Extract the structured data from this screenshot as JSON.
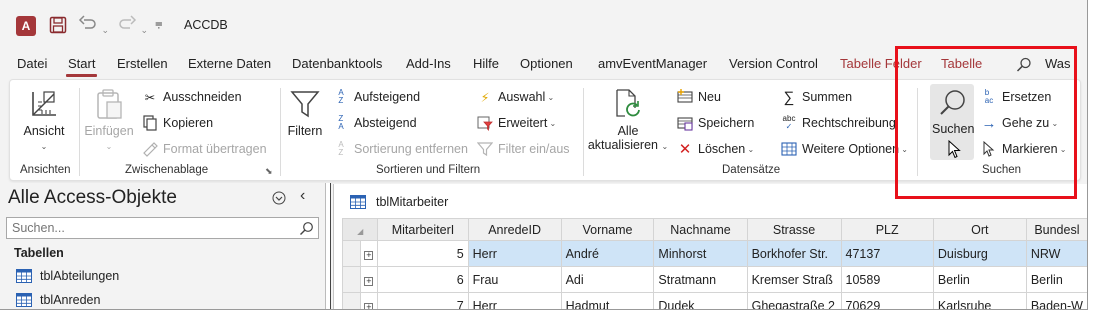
{
  "app": {
    "logo_letter": "A",
    "title": "ACCDB"
  },
  "tabs": [
    {
      "label": "Datei"
    },
    {
      "label": "Start"
    },
    {
      "label": "Erstellen"
    },
    {
      "label": "Externe Daten"
    },
    {
      "label": "Datenbanktools"
    },
    {
      "label": "Add-Ins"
    },
    {
      "label": "Hilfe"
    },
    {
      "label": "Optionen"
    },
    {
      "label": "amvEventManager"
    },
    {
      "label": "Version Control"
    },
    {
      "label": "Tabelle Felder"
    },
    {
      "label": "Tabelle"
    },
    {
      "label": "Was"
    }
  ],
  "ribbon": {
    "ansichten": {
      "group": "Ansichten",
      "ansicht": "Ansicht"
    },
    "zwischenablage": {
      "group": "Zwischenablage",
      "einfuegen": "Einfügen",
      "ausschneiden": "Ausschneiden",
      "kopieren": "Kopieren",
      "format": "Format übertragen"
    },
    "sortieren": {
      "group": "Sortieren und Filtern",
      "filtern": "Filtern",
      "aufsteigend": "Aufsteigend",
      "absteigend": "Absteigend",
      "sortierung_entfernen": "Sortierung entfernen",
      "auswahl": "Auswahl",
      "erweitert": "Erweitert",
      "filter_ein_aus": "Filter ein/aus"
    },
    "datensaetze": {
      "group": "Datensätze",
      "alle": "Alle",
      "aktualisieren": "aktualisieren",
      "neu": "Neu",
      "speichern": "Speichern",
      "loeschen": "Löschen",
      "summen": "Summen",
      "rechtschreibung": "Rechtschreibung",
      "weitere": "Weitere Optionen"
    },
    "suchen": {
      "group": "Suchen",
      "suchen": "Suchen",
      "ersetzen": "Ersetzen",
      "gehe_zu": "Gehe zu",
      "markieren": "Markieren"
    }
  },
  "nav": {
    "title": "Alle Access-Objekte",
    "search_placeholder": "Suchen...",
    "section": "Tabellen",
    "items": [
      {
        "label": "tblAbteilungen"
      },
      {
        "label": "tblAnreden"
      }
    ]
  },
  "document": {
    "tab_title": "tblMitarbeiter",
    "columns": [
      "MitarbeiterI",
      "AnredeID",
      "Vorname",
      "Nachname",
      "Strasse",
      "PLZ",
      "Ort",
      "Bundesl"
    ],
    "rows": [
      [
        "5",
        "Herr",
        "André",
        "Minhorst",
        "Borkhofer Str.",
        "47137",
        "Duisburg",
        "NRW"
      ],
      [
        "6",
        "Frau",
        "Adi",
        "Stratmann",
        "Kremser Straß",
        "10589",
        "Berlin",
        "Berlin"
      ],
      [
        "7",
        "Herr",
        "Hadmut",
        "Dudek",
        "Ghegastraße 2",
        "70629",
        "Karlsruhe",
        "Baden-W"
      ]
    ]
  },
  "colors": {
    "accent": "#a4373a",
    "highlight_box": "#e8101a",
    "selected_row": "#cfe4f7"
  }
}
